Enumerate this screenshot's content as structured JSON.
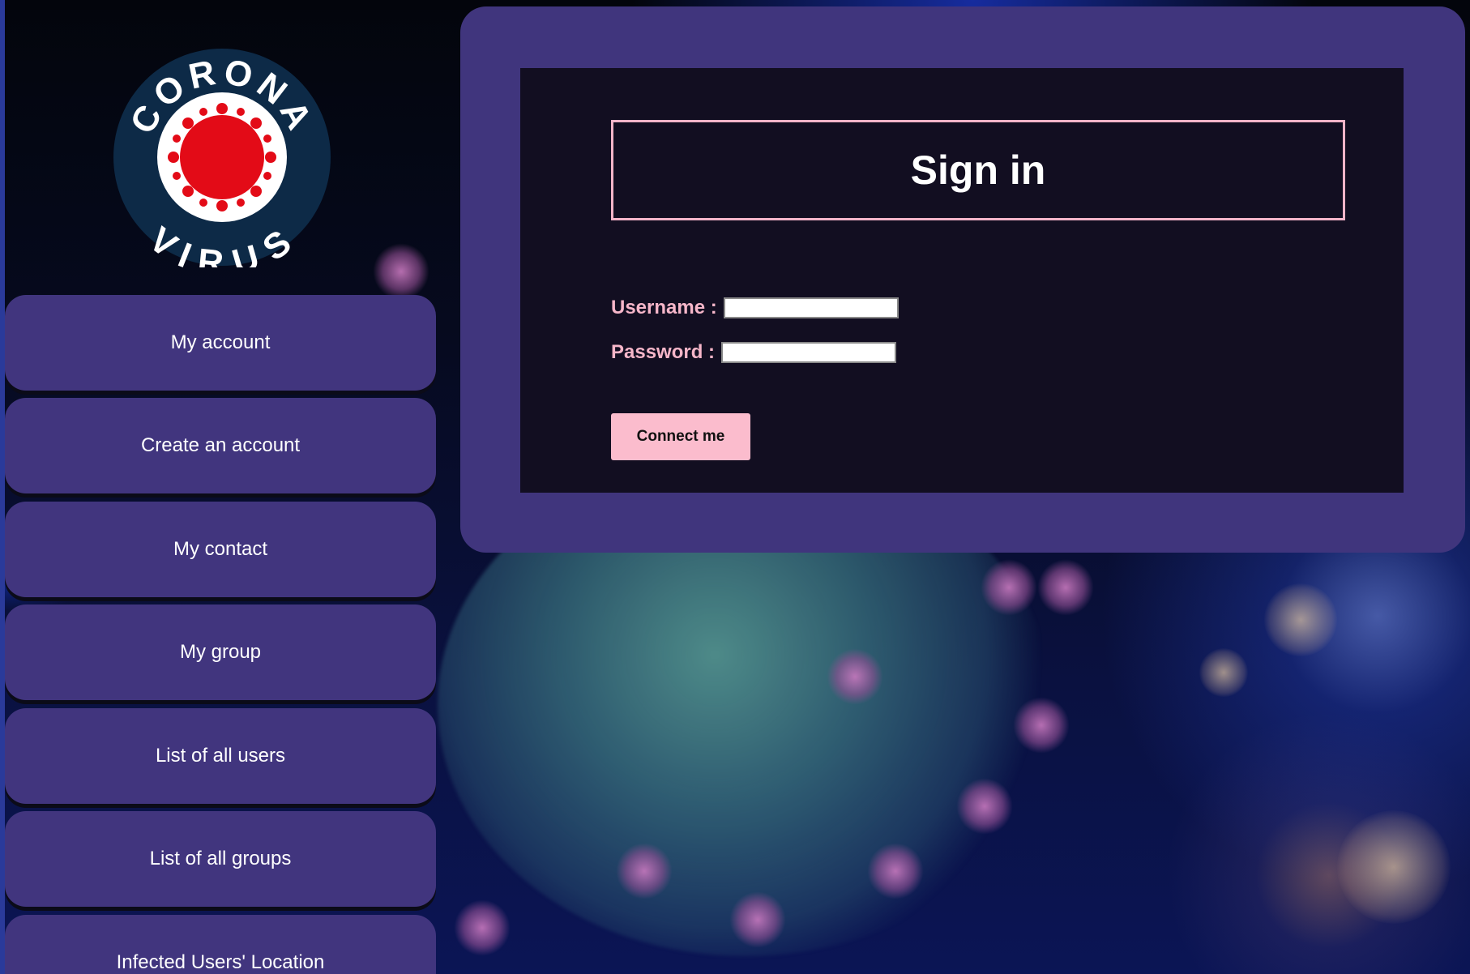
{
  "logo": {
    "top_text": "CORONA",
    "bottom_text": "VIRUS"
  },
  "sidebar": {
    "items": [
      {
        "label": "My account"
      },
      {
        "label": "Create an account"
      },
      {
        "label": "My contact"
      },
      {
        "label": "My group"
      },
      {
        "label": "List of all users"
      },
      {
        "label": "List of all groups"
      },
      {
        "label": "Infected Users' Location"
      }
    ]
  },
  "signin": {
    "title": "Sign in",
    "username_label": "Username :",
    "username_value": "",
    "password_label": "Password :",
    "password_value": "",
    "submit_label": "Connect me"
  },
  "colors": {
    "panel": "#40357d",
    "inner": "#120e21",
    "accent_pink": "#fbbccd",
    "nav_button": "#41357e",
    "logo_red": "#e30b17",
    "logo_navy": "#0d2a47"
  }
}
